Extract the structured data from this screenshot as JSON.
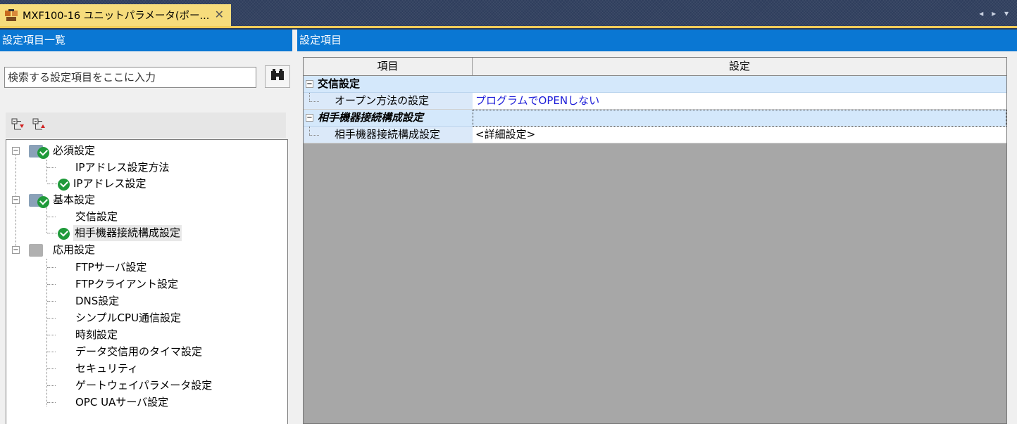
{
  "tab": {
    "title": "MXF100-16 ユニットパラメータ(ポー...",
    "close_glyph": "✕",
    "nav_glyphs": "◂ ▸ ▾"
  },
  "left_panel": {
    "header": "設定項目一覧",
    "search_placeholder": "検索する設定項目をここに入力"
  },
  "right_panel": {
    "header": "設定項目"
  },
  "grid": {
    "col_item": "項目",
    "col_setting": "設定",
    "rows": [
      {
        "type": "group",
        "label": "交信設定",
        "value": ""
      },
      {
        "type": "item",
        "label": "オープン方法の設定",
        "value": "プログラムでOPENしない"
      },
      {
        "type": "group",
        "label": "相手機器接続構成設定",
        "value": ""
      },
      {
        "type": "item",
        "label": "相手機器接続構成設定",
        "value": "<詳細設定>"
      }
    ]
  },
  "tree": {
    "required": "必須設定",
    "ip_method": "IPアドレス設定方法",
    "ip_setting": "IPアドレス設定",
    "basic": "基本設定",
    "comm": "交信設定",
    "partner": "相手機器接続構成設定",
    "applied": "応用設定",
    "ftp_server": "FTPサーバ設定",
    "ftp_client": "FTPクライアント設定",
    "dns": "DNS設定",
    "simple_cpu": "シンプルCPU通信設定",
    "clock": "時刻設定",
    "timer": "データ交信用のタイマ設定",
    "security": "セキュリティ",
    "gateway": "ゲートウェイパラメータ設定",
    "opc": "OPC UAサーバ設定"
  },
  "colors": {
    "header_blue": "#0a77d3",
    "tab_yellow": "#f6dc7c",
    "check_green": "#1f9a3a",
    "value_blue": "#1b1bd8"
  }
}
